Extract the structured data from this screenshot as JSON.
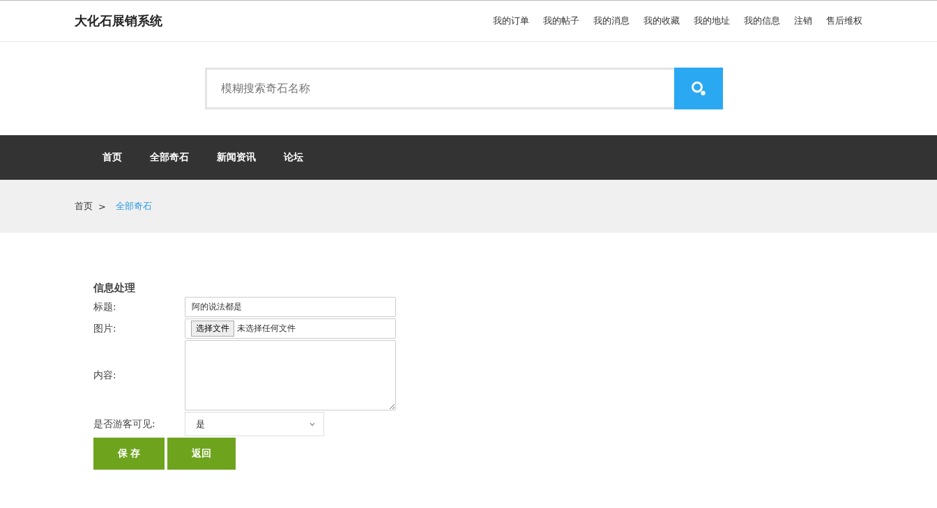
{
  "site_title": "大化石展销系统",
  "user_menu": [
    "我的订单",
    "我的帖子",
    "我的消息",
    "我的收藏",
    "我的地址",
    "我的信息",
    "注销",
    "售后维权"
  ],
  "search": {
    "placeholder": "模糊搜索奇石名称"
  },
  "nav": [
    "首页",
    "全部奇石",
    "新闻资讯",
    "论坛"
  ],
  "breadcrumb": [
    {
      "label": "首页",
      "current": false
    },
    {
      "label": "全部奇石",
      "current": true
    }
  ],
  "breadcrumb_separator": ">",
  "form": {
    "title": "信息处理",
    "fields": [
      {
        "kind": "text",
        "label": "标题:",
        "value": "阿的说法都是"
      },
      {
        "kind": "file",
        "label": "图片:",
        "button": "选择文件",
        "status": "未选择任何文件"
      },
      {
        "kind": "textarea",
        "label": "内容:"
      },
      {
        "kind": "select",
        "label": "是否游客可见:",
        "value": "是"
      }
    ],
    "buttons": [
      "保 存",
      "返回"
    ]
  }
}
